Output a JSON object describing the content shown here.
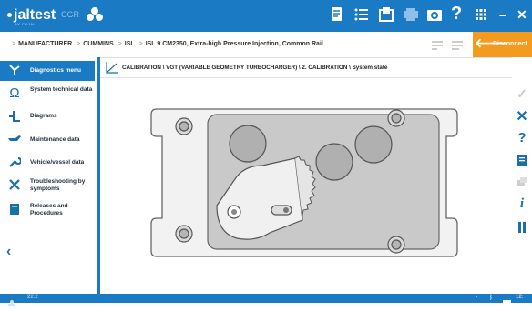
{
  "app": {
    "logo_text": "jaltest",
    "logo_sub": "BY COJALI",
    "product": "CGR",
    "icons": [
      "truck-bus-icon",
      "document-icon",
      "list-icon",
      "inbox-icon",
      "printer-icon",
      "camera-icon",
      "help-icon",
      "grid-icon"
    ]
  },
  "breadcrumb": {
    "items": [
      "MANUFACTURER",
      "CUMMINS",
      "ISL",
      "ISL 9 CM2350, Extra-high Pressure Injection, Common Rail"
    ],
    "disconnect_label": "Disconnect"
  },
  "sidebar": {
    "items": [
      {
        "label": "Diagnostics menu",
        "icon": "diagnostics-icon",
        "active": true
      },
      {
        "label": "System technical data",
        "icon": "ohm-icon"
      },
      {
        "label": "Diagrams",
        "icon": "diagram-icon"
      },
      {
        "label": "Maintenance data",
        "icon": "oil-can-icon"
      },
      {
        "label": "Vehicle/vessel data",
        "icon": "wrench-icon"
      },
      {
        "label": "Troubleshooting by symptoms",
        "icon": "tools-icon"
      },
      {
        "label": "Releases and Procedures",
        "icon": "book-icon"
      }
    ]
  },
  "content": {
    "path": "CALIBRATION \\ VGT (VARIABLE GEOMETRY TURBOCHARGER) \\ 2. CALIBRATION \\ System state"
  },
  "rightbar": {
    "icons": [
      "check-icon",
      "close-icon",
      "help-icon",
      "notes-icon",
      "link-icon",
      "info-icon",
      "pause-icon"
    ]
  },
  "status": {
    "version": "22.2",
    "time": "12:"
  },
  "colors": {
    "primary": "#1a7bc4",
    "accent": "#f39a1f"
  }
}
